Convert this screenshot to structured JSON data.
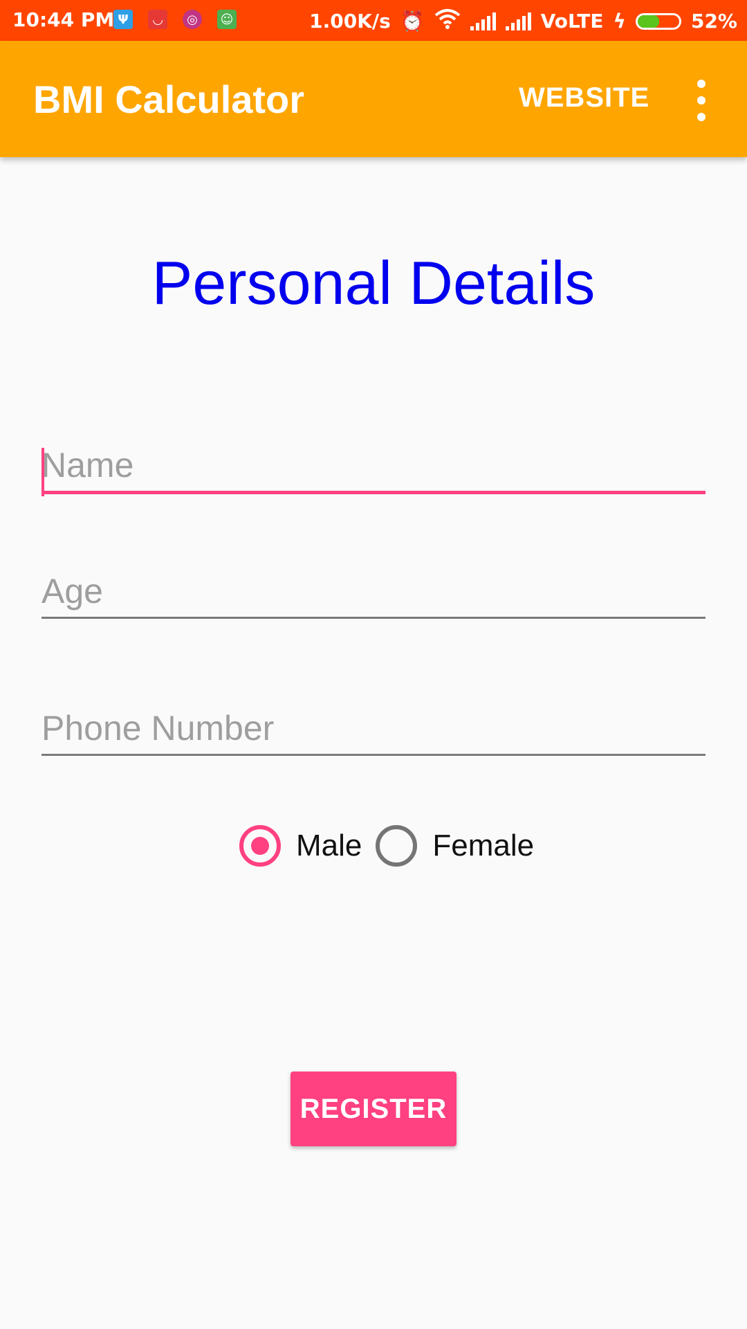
{
  "status_bar": {
    "time": "10:44 PM",
    "net_speed": "1.00K/s",
    "network": "VoLTE",
    "battery_percent": "52%",
    "battery_level": 0.52,
    "notification_icons": [
      "usb-icon",
      "shopping-icon",
      "instagram-icon",
      "android-icon"
    ]
  },
  "app_bar": {
    "title": "BMI Calculator",
    "website_label": "WEBSITE",
    "overflow_icon": "more-vert-icon",
    "color": "#ffa500"
  },
  "form": {
    "heading": "Personal Details",
    "name": {
      "placeholder": "Name",
      "value": ""
    },
    "age": {
      "placeholder": "Age",
      "value": ""
    },
    "phone": {
      "placeholder": "Phone Number",
      "value": ""
    },
    "gender": {
      "options": [
        "Male",
        "Female"
      ],
      "selected": "Male"
    },
    "register_label": "REGISTER"
  },
  "colors": {
    "status_bar": "#ff4500",
    "accent": "#ff4081",
    "heading": "#0000ee"
  }
}
